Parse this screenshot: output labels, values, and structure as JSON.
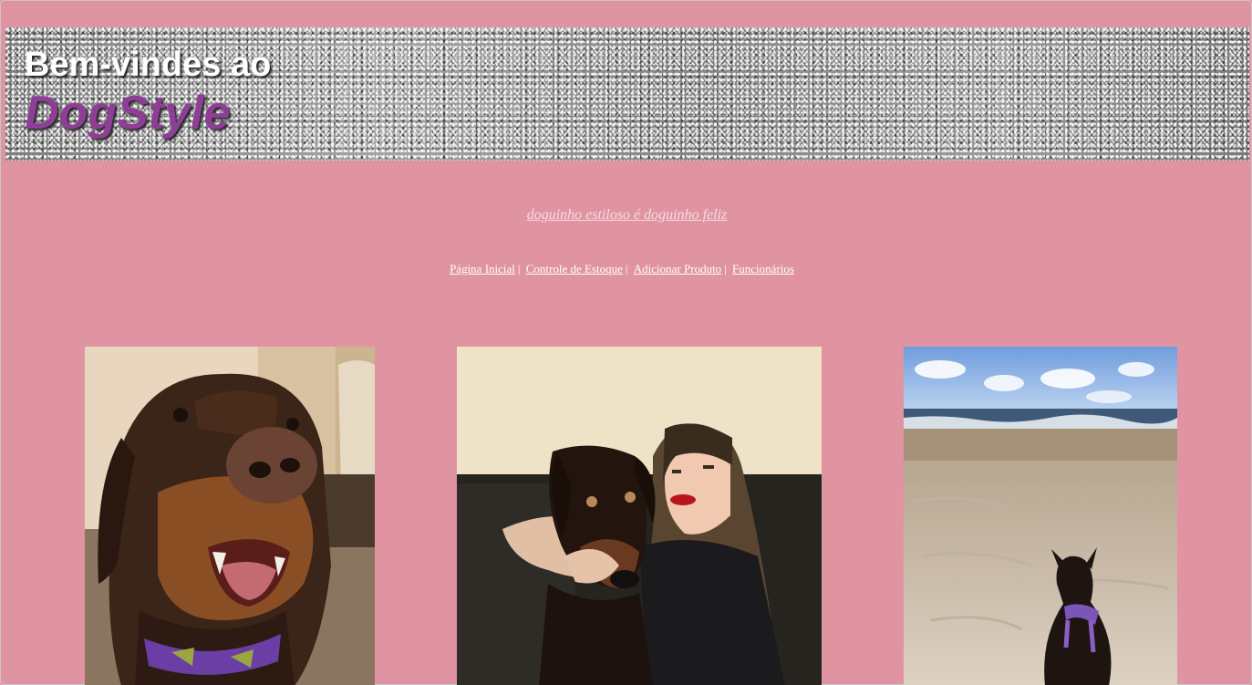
{
  "header": {
    "welcome": "Bem-vindes ao",
    "brand": "DogStyle"
  },
  "tagline": "doguinho estiloso é doguinho feliz",
  "nav": {
    "items": [
      {
        "label": "Página Inicial",
        "separator": "|"
      },
      {
        "label": "Controle de Estoque",
        "separator": "|"
      },
      {
        "label": "Adicionar Produto",
        "separator": "|"
      },
      {
        "label": "Funcionários",
        "separator": ""
      }
    ]
  },
  "photos": [
    {
      "subject": "doberman-closeup-photo"
    },
    {
      "subject": "woman-with-doberman-photo"
    },
    {
      "subject": "doberman-on-beach-photo"
    }
  ],
  "colors": {
    "background": "#e094a2",
    "brand": "#8d3f96",
    "banner": "#8f8f8f"
  }
}
